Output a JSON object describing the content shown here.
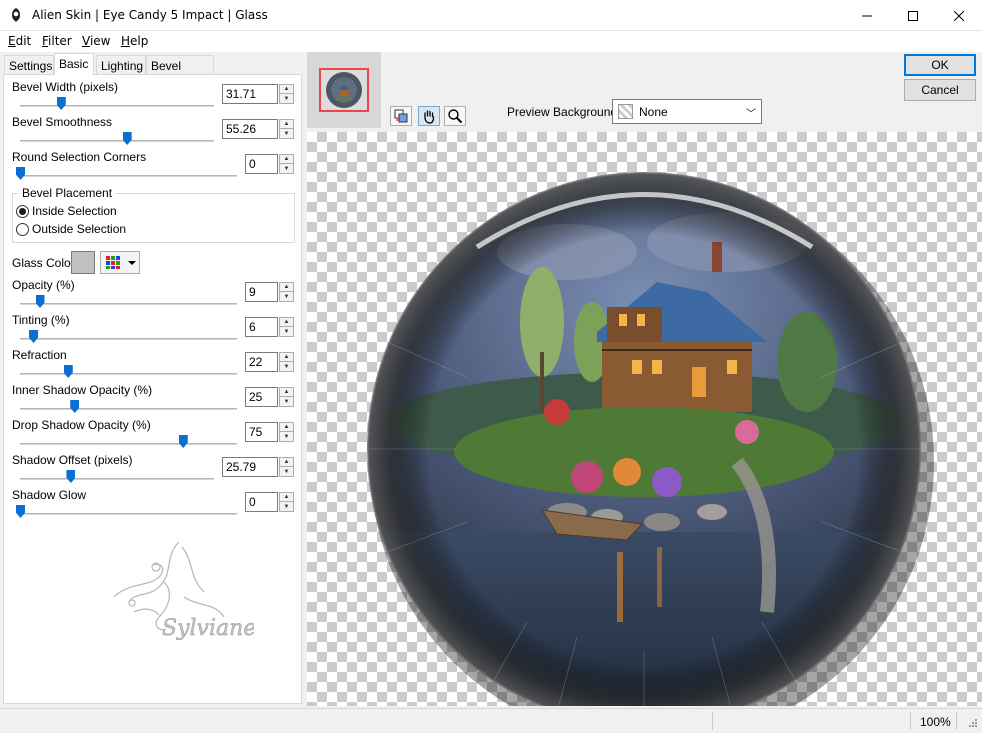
{
  "window": {
    "title": "Alien Skin | Eye Candy 5 Impact | Glass",
    "controls": [
      "minimize-icon",
      "maximize-icon",
      "close-icon"
    ]
  },
  "menu": [
    {
      "accel": "E",
      "rest": "dit"
    },
    {
      "accel": "F",
      "rest": "ilter"
    },
    {
      "accel": "V",
      "rest": "iew"
    },
    {
      "accel": "H",
      "rest": "elp"
    }
  ],
  "tabs": [
    "Settings",
    "Basic",
    "Lighting",
    "Bevel Profile"
  ],
  "active_tab": "Basic",
  "params": {
    "bevel_width": {
      "label": "Bevel Width (pixels)",
      "value": "31.71",
      "level": 0.21
    },
    "bevel_smoothness": {
      "label": "Bevel Smoothness",
      "value": "55.26",
      "level": 0.55
    },
    "round_corners": {
      "label": "Round Selection Corners",
      "value": "0",
      "level": 0.0
    },
    "opacity": {
      "label": "Opacity (%)",
      "value": "9",
      "level": 0.09
    },
    "tinting": {
      "label": "Tinting (%)",
      "value": "6",
      "level": 0.06
    },
    "refraction": {
      "label": "Refraction",
      "value": "22",
      "level": 0.22
    },
    "inner_shadow": {
      "label": "Inner Shadow Opacity (%)",
      "value": "25",
      "level": 0.25
    },
    "drop_shadow": {
      "label": "Drop Shadow Opacity (%)",
      "value": "75",
      "level": 0.75
    },
    "shadow_offset": {
      "label": "Shadow Offset (pixels)",
      "value": "25.79",
      "level": 0.26
    },
    "shadow_glow": {
      "label": "Shadow Glow",
      "value": "0",
      "level": 0.0
    }
  },
  "bevel_placement": {
    "title": "Bevel Placement",
    "options": [
      "Inside Selection",
      "Outside Selection"
    ],
    "selected": "Inside Selection"
  },
  "glass_color": {
    "label": "Glass Color",
    "color": "#c0c0c0"
  },
  "watermark": {
    "text": "Sylviane"
  },
  "preview": {
    "background_label": "Preview Background:",
    "background_value": "None",
    "tools": [
      "preview-toggle-icon",
      "hand-icon",
      "zoom-icon"
    ]
  },
  "buttons": {
    "ok": "OK",
    "cancel": "Cancel"
  },
  "status": {
    "zoom": "100%"
  },
  "colors": {
    "accent": "#0078d7",
    "slider": "#0a6fd1",
    "thumb_frame": "#e8474f"
  }
}
